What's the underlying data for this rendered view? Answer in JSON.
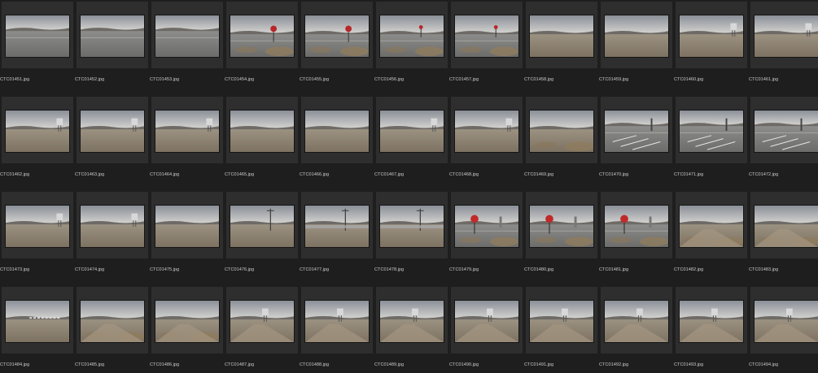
{
  "window": {
    "title": ""
  },
  "colors": {
    "background": "#1e1e1e",
    "cell": "#2e2e2e",
    "filename_text": "#c9c9c9"
  },
  "thumbnails": [
    {
      "filename": "CTC01451.jpg",
      "scene": "road-flat"
    },
    {
      "filename": "CTC01452.jpg",
      "scene": "road-flat"
    },
    {
      "filename": "CTC01453.jpg",
      "scene": "road-flat"
    },
    {
      "filename": "CTC01454.jpg",
      "scene": "stop-sign"
    },
    {
      "filename": "CTC01455.jpg",
      "scene": "stop-sign"
    },
    {
      "filename": "CTC01456.jpg",
      "scene": "stop-sign-far"
    },
    {
      "filename": "CTC01457.jpg",
      "scene": "stop-sign-far"
    },
    {
      "filename": "CTC01458.jpg",
      "scene": "desert-hills"
    },
    {
      "filename": "CTC01459.jpg",
      "scene": "desert-hills"
    },
    {
      "filename": "CTC01460.jpg",
      "scene": "desert-tower"
    },
    {
      "filename": "CTC01461.jpg",
      "scene": "desert-tower"
    },
    {
      "filename": "CTC01462.jpg",
      "scene": "desert-tower"
    },
    {
      "filename": "CTC01463.jpg",
      "scene": "desert-tower"
    },
    {
      "filename": "CTC01464.jpg",
      "scene": "desert-tower"
    },
    {
      "filename": "CTC01465.jpg",
      "scene": "desert-hills"
    },
    {
      "filename": "CTC01466.jpg",
      "scene": "desert-hills"
    },
    {
      "filename": "CTC01467.jpg",
      "scene": "desert-tower"
    },
    {
      "filename": "CTC01468.jpg",
      "scene": "desert-tower"
    },
    {
      "filename": "CTC01469.jpg",
      "scene": "desert-brush"
    },
    {
      "filename": "CTC01470.jpg",
      "scene": "road-marked"
    },
    {
      "filename": "CTC01471.jpg",
      "scene": "road-marked"
    },
    {
      "filename": "CTC01472.jpg",
      "scene": "road-marked"
    },
    {
      "filename": "CTC01473.jpg",
      "scene": "desert-tower"
    },
    {
      "filename": "CTC01474.jpg",
      "scene": "desert-tower"
    },
    {
      "filename": "CTC01475.jpg",
      "scene": "desert-hills"
    },
    {
      "filename": "CTC01476.jpg",
      "scene": "pole-hills"
    },
    {
      "filename": "CTC01477.jpg",
      "scene": "pole-lake"
    },
    {
      "filename": "CTC01478.jpg",
      "scene": "pole-lake"
    },
    {
      "filename": "CTC01479.jpg",
      "scene": "stop-sign-big"
    },
    {
      "filename": "CTC01480.jpg",
      "scene": "stop-sign-big"
    },
    {
      "filename": "CTC01481.jpg",
      "scene": "stop-sign-big"
    },
    {
      "filename": "CTC01482.jpg",
      "scene": "desert-road"
    },
    {
      "filename": "CTC01483.jpg",
      "scene": "desert-road"
    },
    {
      "filename": "CTC01484.jpg",
      "scene": "desert-town"
    },
    {
      "filename": "CTC01485.jpg",
      "scene": "desert-road"
    },
    {
      "filename": "CTC01486.jpg",
      "scene": "desert-road"
    },
    {
      "filename": "CTC01487.jpg",
      "scene": "dirt-road-tower"
    },
    {
      "filename": "CTC01488.jpg",
      "scene": "dirt-road-tower"
    },
    {
      "filename": "CTC01489.jpg",
      "scene": "dirt-road-tower"
    },
    {
      "filename": "CTC01490.jpg",
      "scene": "dirt-road-tower"
    },
    {
      "filename": "CTC01491.jpg",
      "scene": "dirt-road-tower"
    },
    {
      "filename": "CTC01492.jpg",
      "scene": "dirt-road-tower"
    },
    {
      "filename": "CTC01493.jpg",
      "scene": "dirt-road-tower"
    },
    {
      "filename": "CTC01494.jpg",
      "scene": "dirt-road-tower"
    }
  ]
}
